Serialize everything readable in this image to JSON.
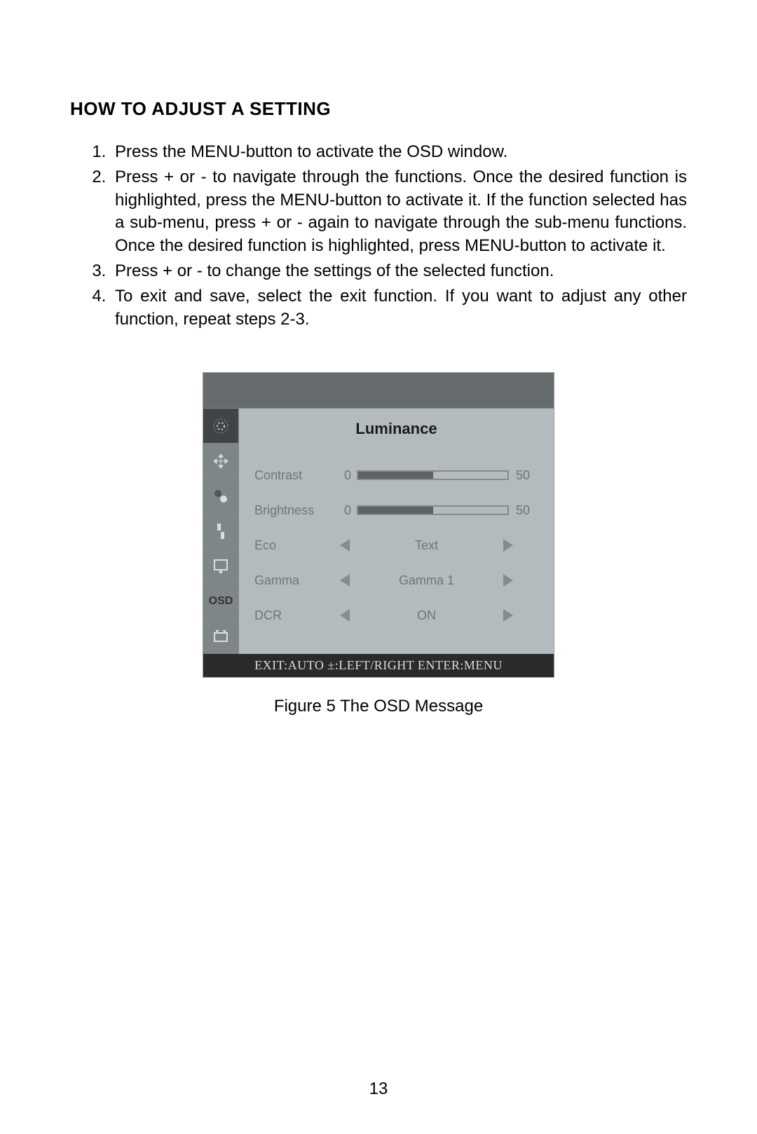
{
  "heading": "HOW TO ADJUST A SETTING",
  "steps": {
    "s1": "Press the MENU-button to activate the OSD window.",
    "s2": "Press + or - to navigate through the functions. Once the desired function is highlighted, press the MENU-button to activate it. If the function selected has a sub-menu, press + or - again to navigate through the sub-menu functions. Once the desired function is highlighted, press MENU-button to activate it.",
    "s3": "Press + or - to change the settings of the selected function.",
    "s4": "To exit and save, select the exit function. If you want to adjust any other function, repeat steps 2-3."
  },
  "osd": {
    "title": "Luminance",
    "rows": {
      "contrast": {
        "label": "Contrast",
        "min": "0",
        "value": "50",
        "pct": 50
      },
      "brightness": {
        "label": "Brightness",
        "min": "0",
        "value": "50",
        "pct": 50
      },
      "eco": {
        "label": "Eco",
        "value": "Text"
      },
      "gamma": {
        "label": "Gamma",
        "value": "Gamma 1"
      },
      "dcr": {
        "label": "DCR",
        "value": "ON"
      }
    },
    "footer": "EXIT:AUTO  ±:LEFT/RIGHT  ENTER:MENU",
    "sidebar_osd_label": "OSD"
  },
  "caption": "Figure 5   The  OSD  Message",
  "page_number": "13"
}
